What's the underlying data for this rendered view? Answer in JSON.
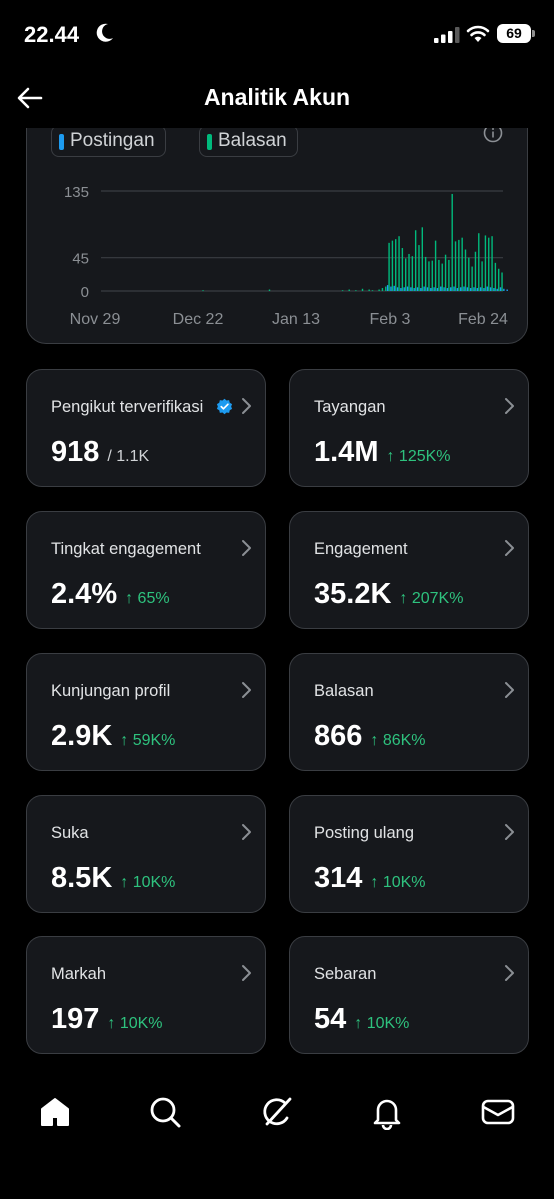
{
  "status": {
    "time": "22.44",
    "battery": "69"
  },
  "header": {
    "title": "Analitik Akun"
  },
  "chart": {
    "legend": [
      {
        "label": "Postingan",
        "color": "#1d9bf0"
      },
      {
        "label": "Balasan",
        "color": "#00ba7c"
      }
    ],
    "chart_data": {
      "type": "bar",
      "y_ticks": [
        "135",
        "45",
        "0"
      ],
      "x_ticks": [
        "Nov 29",
        "Dec 22",
        "Jan 13",
        "Feb 3",
        "Feb 24"
      ],
      "ylim": [
        0,
        135
      ],
      "series": [
        {
          "name": "Postingan",
          "values": [
            0,
            0,
            0,
            0,
            0,
            0,
            0,
            0,
            0,
            0,
            0,
            0,
            0,
            0,
            0,
            0,
            0,
            0,
            0,
            0,
            0,
            0,
            0,
            0,
            0,
            0,
            0,
            0,
            0,
            0,
            0,
            0,
            0,
            0,
            0,
            0,
            0,
            0,
            0,
            0,
            0,
            0,
            0,
            0,
            0,
            0,
            0,
            0,
            0,
            0,
            0,
            0,
            0,
            0,
            0,
            0,
            0,
            0,
            0,
            0,
            0,
            0,
            0,
            0,
            0,
            0,
            0,
            0,
            0,
            0,
            0,
            0,
            0,
            0,
            0,
            0,
            0,
            0,
            0,
            0,
            0,
            0,
            0,
            0,
            0,
            0,
            8,
            6,
            7,
            5,
            4,
            5,
            6,
            5,
            4,
            5,
            4,
            6,
            5,
            4,
            5,
            4,
            6,
            5,
            4,
            5,
            6,
            4,
            5,
            6,
            5,
            4,
            5,
            4,
            5,
            4,
            6,
            5,
            4,
            3,
            5,
            3,
            2
          ]
        },
        {
          "name": "Balasan",
          "values": [
            0,
            0,
            0,
            0,
            0,
            0,
            0,
            0,
            0,
            0,
            0,
            0,
            0,
            0,
            0,
            0,
            0,
            0,
            0,
            0,
            0,
            0,
            0,
            0,
            0,
            0,
            0,
            0,
            0,
            0,
            1,
            0,
            0,
            0,
            0,
            0,
            0,
            0,
            0,
            0,
            0,
            0,
            0,
            0,
            0,
            0,
            0,
            0,
            0,
            0,
            2,
            0,
            0,
            0,
            0,
            0,
            0,
            0,
            0,
            0,
            0,
            0,
            0,
            0,
            0,
            0,
            0,
            0,
            0,
            0,
            0,
            0,
            1,
            0,
            2,
            0,
            1,
            0,
            3,
            0,
            2,
            1,
            0,
            2,
            4,
            6,
            65,
            68,
            70,
            74,
            58,
            44,
            50,
            47,
            82,
            62,
            86,
            46,
            40,
            41,
            68,
            42,
            37,
            49,
            42,
            131,
            67,
            69,
            72,
            56,
            45,
            33,
            53,
            78,
            40,
            75,
            72,
            74,
            38,
            30,
            25
          ]
        }
      ]
    }
  },
  "cards": [
    {
      "label": "Pengikut terverifikasi",
      "value": "918",
      "sub": "/ 1.1K",
      "delta": "",
      "verified": true
    },
    {
      "label": "Tayangan",
      "value": "1.4M",
      "sub": "",
      "delta": "↑ 125K%"
    },
    {
      "label": "Tingkat engagement",
      "value": "2.4%",
      "sub": "",
      "delta": "↑ 65%"
    },
    {
      "label": "Engagement",
      "value": "35.2K",
      "sub": "",
      "delta": "↑ 207K%"
    },
    {
      "label": "Kunjungan profil",
      "value": "2.9K",
      "sub": "",
      "delta": "↑ 59K%"
    },
    {
      "label": "Balasan",
      "value": "866",
      "sub": "",
      "delta": "↑ 86K%"
    },
    {
      "label": "Suka",
      "value": "8.5K",
      "sub": "",
      "delta": "↑ 10K%"
    },
    {
      "label": "Posting ulang",
      "value": "314",
      "sub": "",
      "delta": "↑ 10K%"
    },
    {
      "label": "Markah",
      "value": "197",
      "sub": "",
      "delta": "↑ 10K%"
    },
    {
      "label": "Sebaran",
      "value": "54",
      "sub": "",
      "delta": "↑ 10K%"
    }
  ],
  "tabs": [
    "home-icon",
    "search-icon",
    "grok-icon",
    "bell-icon",
    "mail-icon"
  ]
}
